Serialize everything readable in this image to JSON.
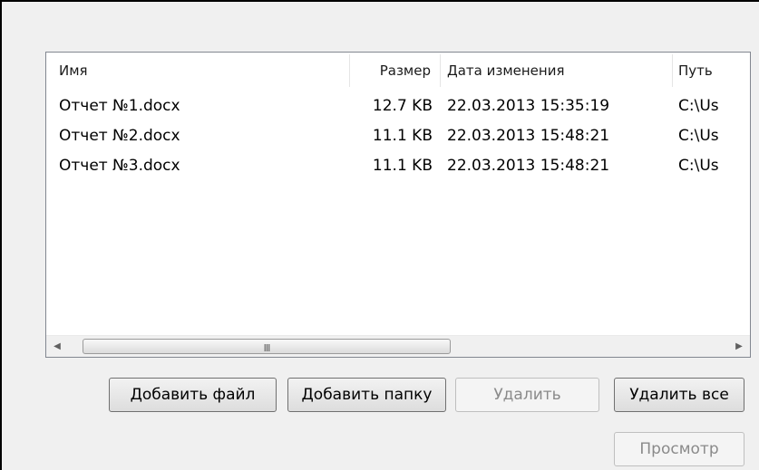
{
  "list": {
    "columns": {
      "name": "Имя",
      "size": "Размер",
      "date": "Дата изменения",
      "path": "Путь"
    },
    "rows": [
      {
        "name": "Отчет №1.docx",
        "size": "12.7 KB",
        "date": "22.03.2013 15:35:19",
        "path": "C:\\Us"
      },
      {
        "name": "Отчет №2.docx",
        "size": "11.1 KB",
        "date": "22.03.2013 15:48:21",
        "path": "C:\\Us"
      },
      {
        "name": "Отчет №3.docx",
        "size": "11.1 KB",
        "date": "22.03.2013 15:48:21",
        "path": "C:\\Us"
      }
    ],
    "scroll_grip": "III"
  },
  "buttons": {
    "add_file": "Добавить файл",
    "add_folder": "Добавить папку",
    "delete": "Удалить",
    "delete_all": "Удалить все",
    "preview": "Просмотр"
  },
  "icons": {
    "scroll_left": "scroll-left-arrow-icon",
    "scroll_right": "scroll-right-arrow-icon"
  }
}
